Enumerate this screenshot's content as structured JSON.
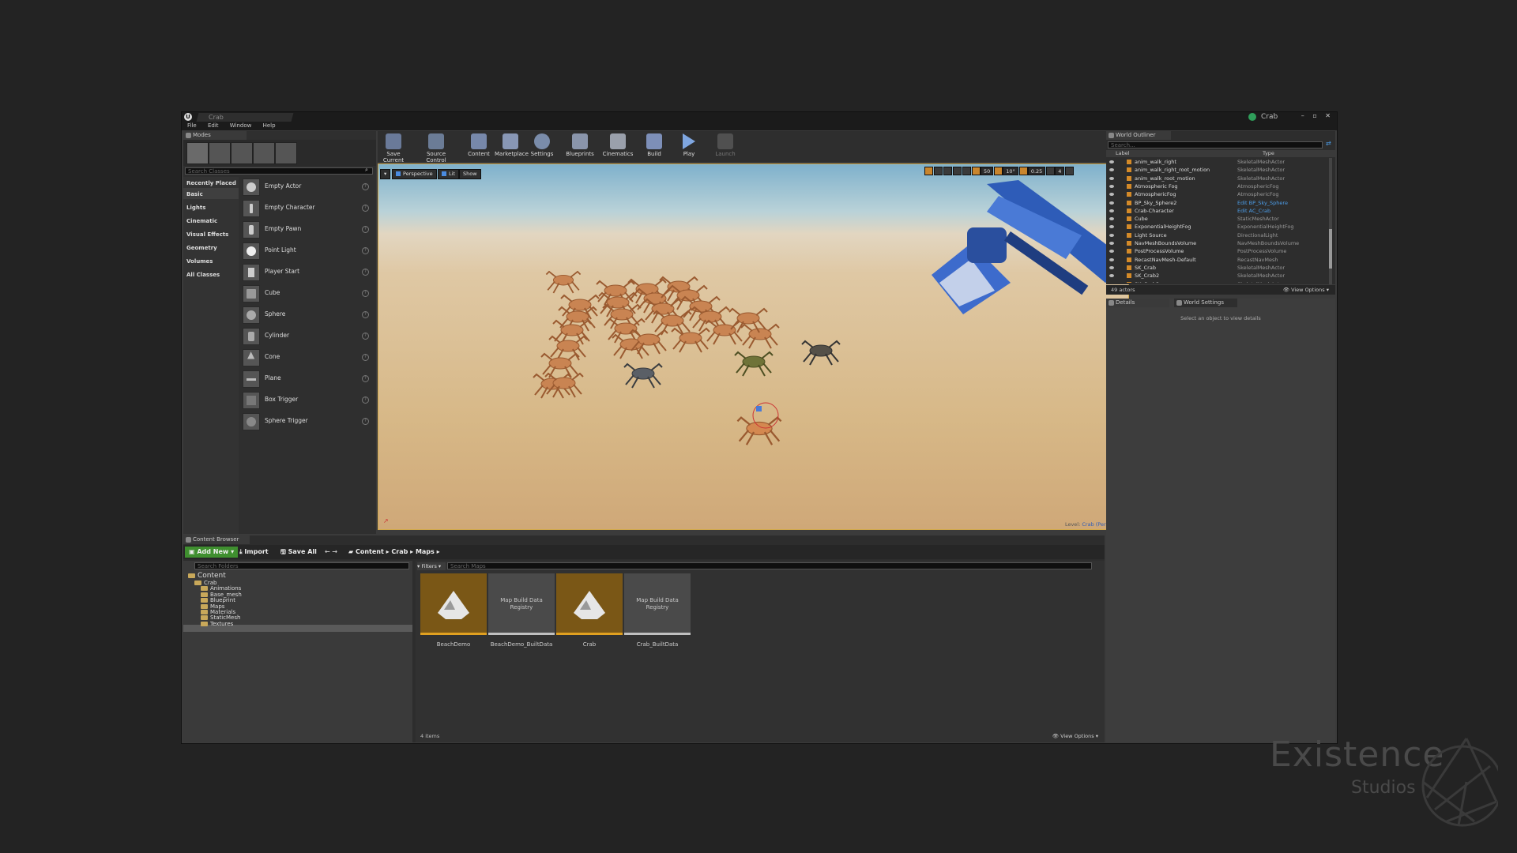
{
  "window": {
    "doc_tab": "Crab",
    "project": "Crab",
    "controls": "– ▫ ✕",
    "menu": [
      "File",
      "Edit",
      "Window",
      "Help"
    ]
  },
  "modes": {
    "tab": "Modes",
    "search_placeholder": "Search Classes",
    "categories": [
      "Recently Placed",
      "Basic",
      "Lights",
      "Cinematic",
      "Visual Effects",
      "Geometry",
      "Volumes",
      "All Classes"
    ],
    "items": [
      "Empty Actor",
      "Empty Character",
      "Empty Pawn",
      "Point Light",
      "Player Start",
      "Cube",
      "Sphere",
      "Cylinder",
      "Cone",
      "Plane",
      "Box Trigger",
      "Sphere Trigger"
    ]
  },
  "toolbar": {
    "buttons": [
      "Save Current",
      "Source Control",
      "Content",
      "Marketplace",
      "Settings",
      "Blueprints",
      "Cinematics",
      "Build",
      "Play",
      "Launch"
    ]
  },
  "viewport": {
    "perspective": "Perspective",
    "lit": "Lit",
    "show": "Show",
    "snap_values": [
      "50",
      "10°",
      "0.25",
      "4"
    ],
    "level_label": "Level:",
    "level_name": "Crab (Persistent)"
  },
  "outliner": {
    "tab": "World Outliner",
    "search_placeholder": "Search...",
    "col_label": "Label",
    "col_type": "Type",
    "rows": [
      {
        "label": "anim_walk_right",
        "type": "SkeletalMeshActor"
      },
      {
        "label": "anim_walk_right_root_motion",
        "type": "SkeletalMeshActor"
      },
      {
        "label": "anim_walk_root_motion",
        "type": "SkeletalMeshActor"
      },
      {
        "label": "Atmospheric Fog",
        "type": "AtmosphericFog"
      },
      {
        "label": "AtmosphericFog",
        "type": "AtmosphericFog"
      },
      {
        "label": "BP_Sky_Sphere2",
        "type": "Edit BP_Sky_Sphere"
      },
      {
        "label": "Crab-Character",
        "type": "Edit AC_Crab"
      },
      {
        "label": "Cube",
        "type": "StaticMeshActor"
      },
      {
        "label": "ExponentialHeightFog",
        "type": "ExponentialHeightFog"
      },
      {
        "label": "Light Source",
        "type": "DirectionalLight"
      },
      {
        "label": "NavMeshBoundsVolume",
        "type": "NavMeshBoundsVolume"
      },
      {
        "label": "PostProcessVolume",
        "type": "PostProcessVolume"
      },
      {
        "label": "RecastNavMesh-Default",
        "type": "RecastNavMesh"
      },
      {
        "label": "SK_Crab",
        "type": "SkeletalMeshActor"
      },
      {
        "label": "SK_Crab2",
        "type": "SkeletalMeshActor"
      },
      {
        "label": "SK_Crab3",
        "type": "SkeletalMeshActor"
      }
    ],
    "count": "49 actors",
    "view_options": "View Options"
  },
  "details": {
    "tab": "Details",
    "tab2": "World Settings",
    "empty": "Select an object to view details"
  },
  "content_browser": {
    "tab": "Content Browser",
    "add_new": "Add New",
    "import": "Import",
    "save_all": "Save All",
    "path": [
      "Content",
      "Crab",
      "Maps"
    ],
    "folder_search": "Search Folders",
    "filters": "Filters",
    "asset_search": "Search Maps",
    "tree": [
      {
        "name": "Content",
        "level": 0
      },
      {
        "name": "Crab",
        "level": 1
      },
      {
        "name": "Animations",
        "level": 2
      },
      {
        "name": "Base_mesh",
        "level": 2
      },
      {
        "name": "Blueprint",
        "level": 2
      },
      {
        "name": "Maps",
        "level": 2
      },
      {
        "name": "Materials",
        "level": 2
      },
      {
        "name": "StaticMesh",
        "level": 2
      },
      {
        "name": "Textures",
        "level": 2
      }
    ],
    "assets": [
      {
        "name": "BeachDemo",
        "kind": "map",
        "thumb_text": ""
      },
      {
        "name": "BeachDemo_BuiltData",
        "kind": "data",
        "thumb_text": "Map Build Data Registry"
      },
      {
        "name": "Crab",
        "kind": "map",
        "thumb_text": ""
      },
      {
        "name": "Crab_BuiltData",
        "kind": "data",
        "thumb_text": "Map Build Data Registry"
      }
    ],
    "count": "4 items",
    "view_options": "View Options"
  },
  "watermark": {
    "line1": "Existence",
    "line2": "Studios"
  },
  "colors": {
    "accent": "#d2a94a",
    "map_thumb": "#7a5716",
    "link": "#4c9eea",
    "add_new": "#3f8f2f"
  }
}
